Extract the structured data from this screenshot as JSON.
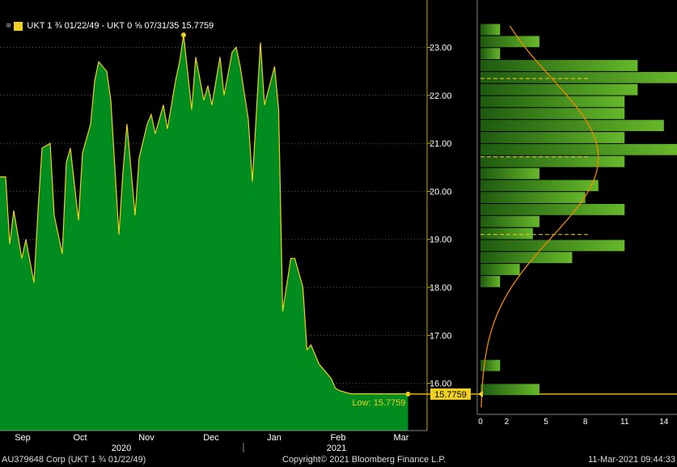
{
  "legend": {
    "text": "UKT 1 ¾ 01/22/49 - UKT 0 ⅝ 07/31/35 15.7759",
    "swatch_color": "#f0d020"
  },
  "chart_data": [
    {
      "type": "area",
      "series": [
        {
          "name": "UKT 1 ¾ 01/22/49 - UKT 0 ⅝ 07/31/35",
          "color": "#f0d020",
          "fill": "#008c1e",
          "x": [
            "2020-08-24",
            "2020-08-26",
            "2020-08-28",
            "2020-09-01",
            "2020-09-03",
            "2020-09-07",
            "2020-09-09",
            "2020-09-11",
            "2020-09-15",
            "2020-09-17",
            "2020-09-21",
            "2020-09-23",
            "2020-09-25",
            "2020-09-29",
            "2020-10-01",
            "2020-10-05",
            "2020-10-07",
            "2020-10-09",
            "2020-10-13",
            "2020-10-15",
            "2020-10-19",
            "2020-10-21",
            "2020-10-23",
            "2020-10-27",
            "2020-10-29",
            "2020-11-02",
            "2020-11-04",
            "2020-11-06",
            "2020-11-10",
            "2020-11-12",
            "2020-11-16",
            "2020-11-18",
            "2020-11-20",
            "2020-11-24",
            "2020-11-26",
            "2020-11-30",
            "2020-12-02",
            "2020-12-04",
            "2020-12-08",
            "2020-12-10",
            "2020-12-14",
            "2020-12-16",
            "2020-12-18",
            "2020-12-22",
            "2020-12-24",
            "2020-12-28",
            "2020-12-30",
            "2021-01-04",
            "2021-01-06",
            "2021-01-08",
            "2021-01-12",
            "2021-01-14",
            "2021-01-18",
            "2021-01-20",
            "2021-01-22",
            "2021-01-26",
            "2021-01-28",
            "2021-02-01",
            "2021-02-03",
            "2021-02-05",
            "2021-02-09",
            "2021-02-11",
            "2021-02-15",
            "2021-02-17",
            "2021-02-19",
            "2021-02-23",
            "2021-02-25",
            "2021-03-01",
            "2021-03-03",
            "2021-03-05",
            "2021-03-09",
            "2021-03-11"
          ],
          "values": [
            20.3,
            18.9,
            19.6,
            18.6,
            19.0,
            18.1,
            19.6,
            20.9,
            21.0,
            19.5,
            18.7,
            20.6,
            20.9,
            19.4,
            20.8,
            21.4,
            22.3,
            22.7,
            22.5,
            21.9,
            19.1,
            20.4,
            21.4,
            19.5,
            20.7,
            21.4,
            21.6,
            21.2,
            21.8,
            21.3,
            22.3,
            22.7,
            23.26,
            21.7,
            22.8,
            21.9,
            22.2,
            21.8,
            22.8,
            22.0,
            22.9,
            23.0,
            22.6,
            21.5,
            20.2,
            23.1,
            21.8,
            22.6,
            21.7,
            17.5,
            18.6,
            18.6,
            18.0,
            16.7,
            16.8,
            16.4,
            16.3,
            16.1,
            15.9,
            15.85,
            15.8,
            15.78,
            15.78,
            15.78,
            15.78,
            15.78,
            15.78,
            15.78,
            15.78,
            15.78,
            15.78,
            15.7759
          ]
        }
      ],
      "annotations": [
        {
          "label": "23.2586",
          "value": 23.2586
        },
        {
          "label": "Low: 15.7759",
          "value": 15.7759
        },
        {
          "label": "15.7759",
          "value": 15.7759,
          "kind": "last-price-tag"
        }
      ],
      "yticks": [
        "16.00",
        "17.00",
        "18.00",
        "19.00",
        "20.00",
        "21.00",
        "22.00",
        "23.00"
      ],
      "ylim": [
        15.5,
        23.5
      ],
      "xticks_month": [
        "Sep",
        "Oct",
        "Nov",
        "Dec",
        "Jan",
        "Feb",
        "Mar"
      ],
      "xticks_year": [
        "2020",
        "2021"
      ],
      "grid": true
    },
    {
      "type": "bar",
      "orientation": "horizontal",
      "bins": [
        23.37,
        23.12,
        22.87,
        22.62,
        22.37,
        22.12,
        21.87,
        21.62,
        21.37,
        21.12,
        20.87,
        20.62,
        20.37,
        20.12,
        19.87,
        19.62,
        19.37,
        19.12,
        18.87,
        18.62,
        18.37,
        18.12,
        16.37,
        15.87
      ],
      "values": [
        1.5,
        4.5,
        1.5,
        12,
        15,
        12,
        11,
        11,
        14,
        11,
        15,
        11,
        4.5,
        9,
        8,
        11,
        4.5,
        4,
        11,
        7,
        3,
        1.5,
        1.5,
        4.5
      ],
      "xticks": [
        "0",
        "2",
        "5",
        "8",
        "11",
        "14"
      ],
      "xlim": [
        0,
        14
      ],
      "color": "#4a9a1c",
      "normal_curve": {
        "mean": 20.7,
        "std": 1.65,
        "peak": 9
      },
      "dashed_levels": [
        22.35,
        20.72,
        19.1
      ]
    }
  ],
  "footer": {
    "left": "AU379648 Corp (UKT 1 ¾ 01/22/49)",
    "center": "Copyright© 2021 Bloomberg Finance L.P.",
    "right": "11-Mar-2021 09:44:33"
  }
}
